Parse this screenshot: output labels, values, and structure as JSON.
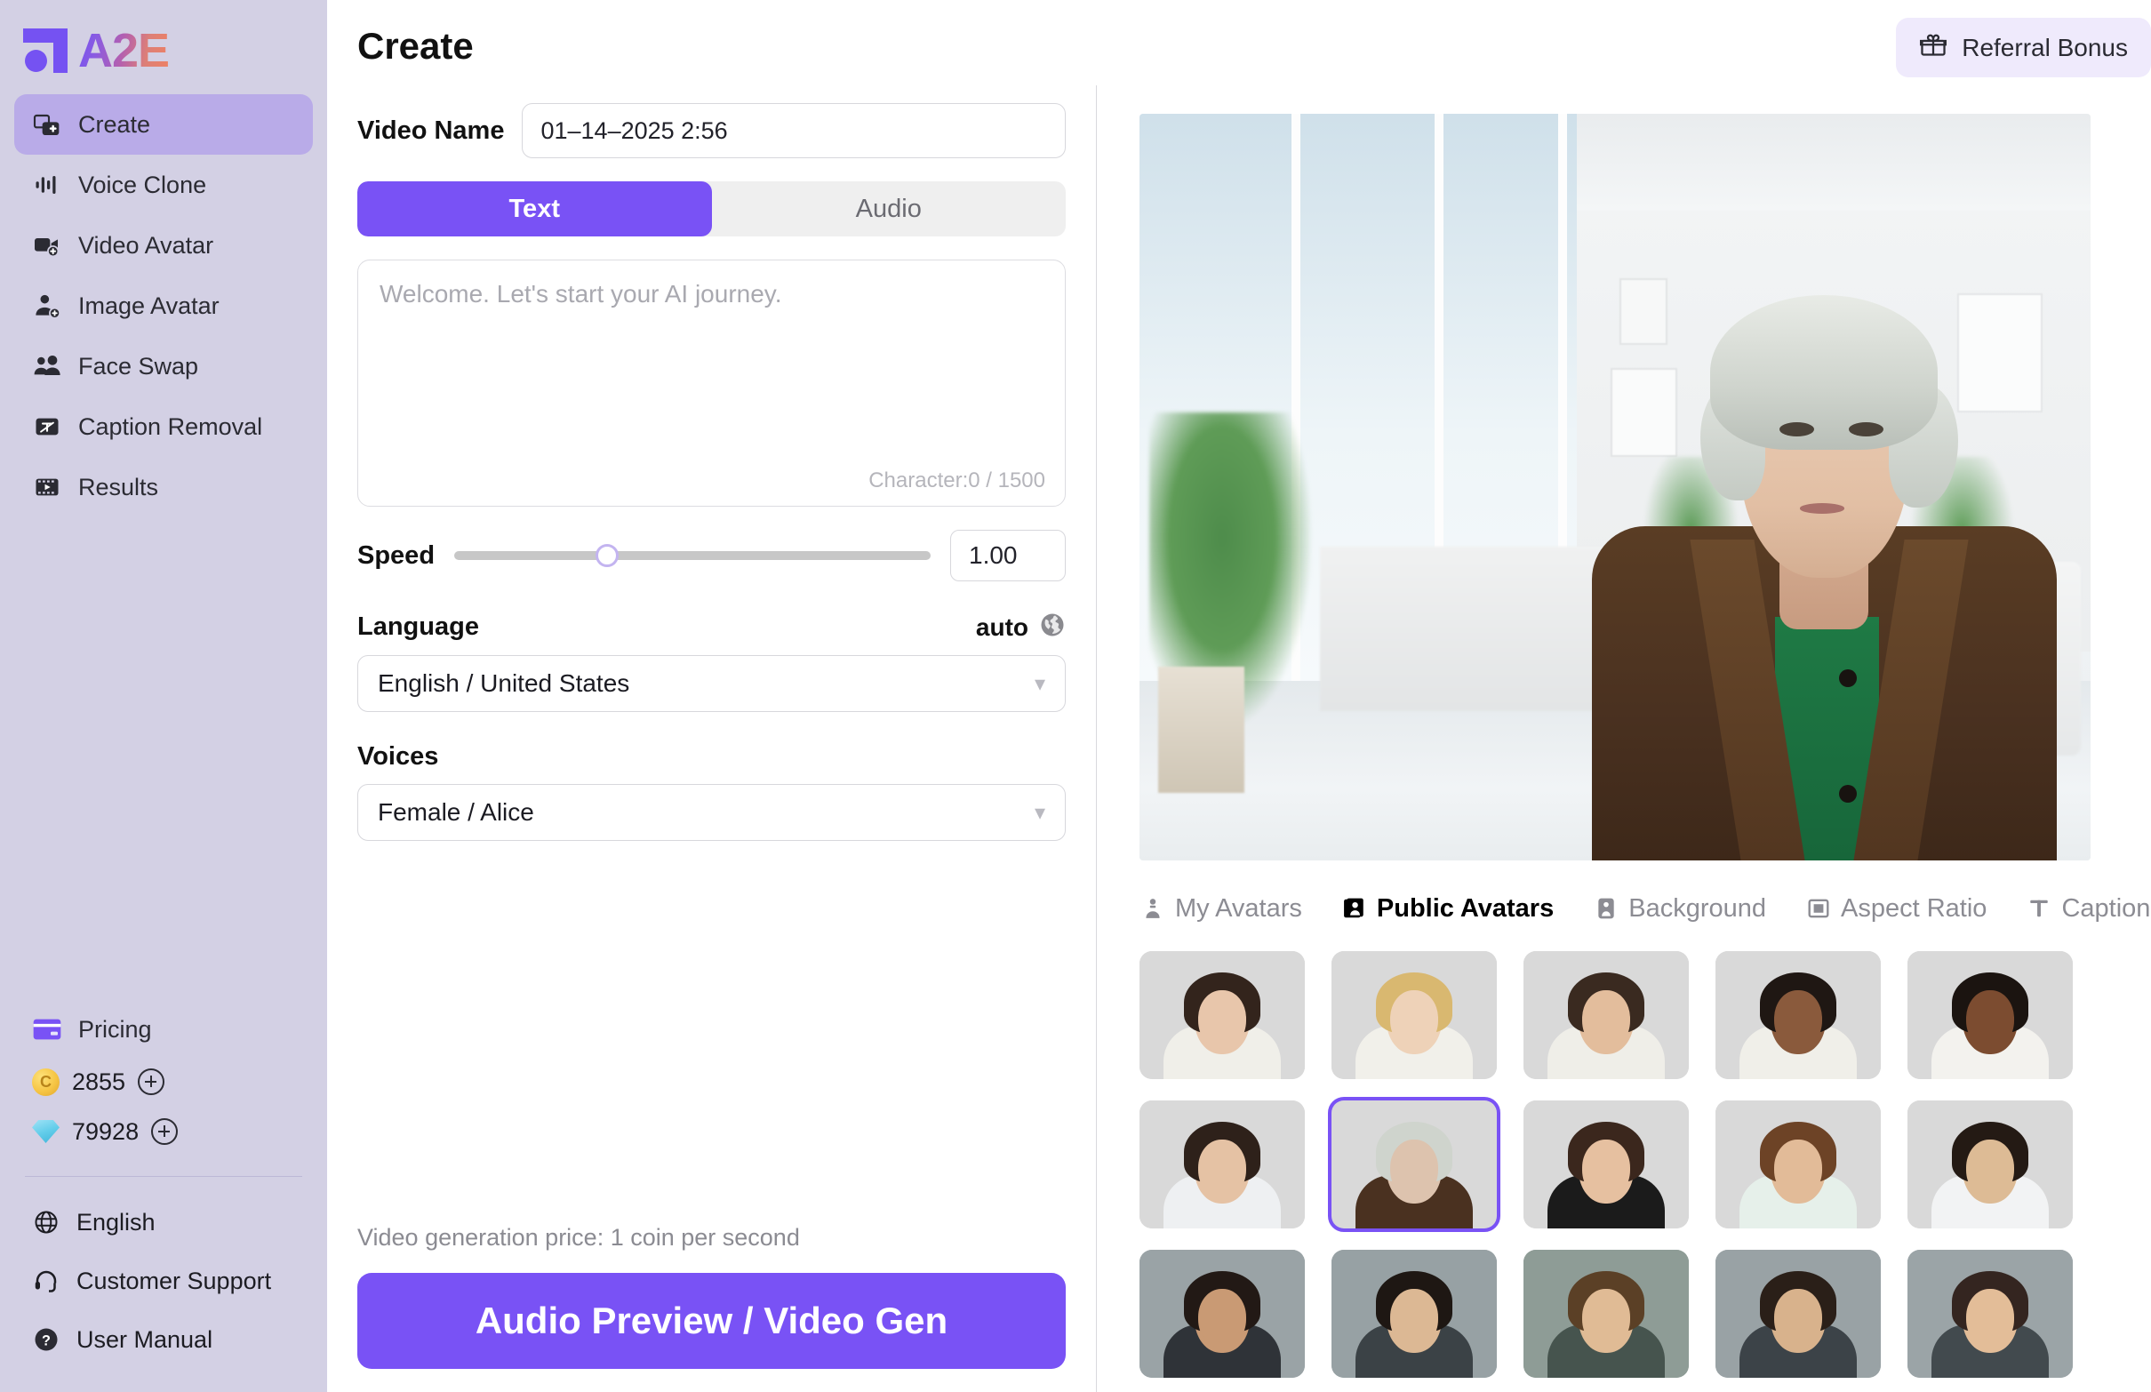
{
  "brand": {
    "name": "A2E"
  },
  "sidebar": {
    "items": [
      {
        "label": "Create",
        "icon": "create-icon",
        "active": true
      },
      {
        "label": "Voice Clone",
        "icon": "voice-clone-icon",
        "active": false
      },
      {
        "label": "Video Avatar",
        "icon": "video-avatar-icon",
        "active": false
      },
      {
        "label": "Image Avatar",
        "icon": "image-avatar-icon",
        "active": false
      },
      {
        "label": "Face Swap",
        "icon": "face-swap-icon",
        "active": false
      },
      {
        "label": "Caption Removal",
        "icon": "caption-removal-icon",
        "active": false
      },
      {
        "label": "Results",
        "icon": "results-icon",
        "active": false
      }
    ],
    "pricing": {
      "label": "Pricing",
      "icon": "credit-card-icon"
    },
    "credits": {
      "coins": {
        "value": "2855",
        "icon": "coin-icon",
        "add": "+"
      },
      "diamonds": {
        "value": "79928",
        "icon": "diamond-icon",
        "add": "+"
      }
    },
    "footer": [
      {
        "label": "English",
        "icon": "globe-icon"
      },
      {
        "label": "Customer Support",
        "icon": "headset-icon"
      },
      {
        "label": "User Manual",
        "icon": "question-circle-icon"
      }
    ]
  },
  "header": {
    "title": "Create",
    "referral": {
      "label": "Referral Bonus",
      "icon": "gift-icon"
    }
  },
  "form": {
    "video_name_label": "Video Name",
    "video_name_value": "01–14–2025 2:56",
    "video_name_placeholder": "Video Name",
    "mode_tabs": [
      {
        "label": "Text",
        "active": true
      },
      {
        "label": "Audio",
        "active": false
      }
    ],
    "script_placeholder": "Welcome. Let's start your AI journey.",
    "script_value": "",
    "character_counter": "Character:0 / 1500",
    "speed_label": "Speed",
    "speed_value": "1.00",
    "speed_percent": 32,
    "language_label": "Language",
    "language_auto": "auto",
    "language_auto_icon": "globe-earth-icon",
    "language_value": "English / United States",
    "voices_label": "Voices",
    "voices_value": "Female / Alice",
    "price_note": "Video generation price: 1 coin per second",
    "cta_label": "Audio Preview / Video Gen"
  },
  "preview": {
    "alt": "AI avatar preview: elderly woman in brown coat and green top in a bright clinic",
    "tabs": [
      {
        "label": "My Avatars",
        "icon": "person-badge-icon",
        "active": false
      },
      {
        "label": "Public Avatars",
        "icon": "people-card-icon",
        "active": true
      },
      {
        "label": "Background",
        "icon": "image-person-icon",
        "active": false
      },
      {
        "label": "Aspect Ratio",
        "icon": "aspect-ratio-icon",
        "active": false
      },
      {
        "label": "Caption",
        "icon": "text-type-icon",
        "active": false
      }
    ],
    "avatars": [
      {
        "name": "avatar-1",
        "skin": "#e8c6ab",
        "hair": "#33241c",
        "shirt": "#f0efe9",
        "bg": "#d9d9d9",
        "selected": false
      },
      {
        "name": "avatar-2",
        "skin": "#eed2b8",
        "hair": "#d9b870",
        "shirt": "#f1f0ea",
        "bg": "#d9d9d9",
        "selected": false
      },
      {
        "name": "avatar-3",
        "skin": "#e3bd9c",
        "hair": "#3a2a20",
        "shirt": "#efeee8",
        "bg": "#d9d9d9",
        "selected": false
      },
      {
        "name": "avatar-4",
        "skin": "#8a5a3c",
        "hair": "#1f1713",
        "shirt": "#f0efe9",
        "bg": "#d9d9d9",
        "selected": false
      },
      {
        "name": "avatar-5",
        "skin": "#7c4c30",
        "hair": "#1b1410",
        "shirt": "#f3f2ee",
        "bg": "#d9d9d9",
        "selected": false
      },
      {
        "name": "avatar-6",
        "skin": "#e5c2a4",
        "hair": "#2e211a",
        "shirt": "#eef0f2",
        "bg": "#d9d9d9",
        "selected": false
      },
      {
        "name": "avatar-7",
        "skin": "#ddc3ae",
        "hair": "#cfd4cd",
        "shirt": "#4a3120",
        "bg": "#d9d9d9",
        "selected": true
      },
      {
        "name": "avatar-8",
        "skin": "#e6c0a0",
        "hair": "#3b271d",
        "shirt": "#1b1b1b",
        "bg": "#d9d9d9",
        "selected": false
      },
      {
        "name": "avatar-9",
        "skin": "#e2bb98",
        "hair": "#6d4326",
        "shirt": "#e6f0ea",
        "bg": "#d9d9d9",
        "selected": false
      },
      {
        "name": "avatar-10",
        "skin": "#ddbb95",
        "hair": "#241a14",
        "shirt": "#f2f3f4",
        "bg": "#d9d9d9",
        "selected": false
      },
      {
        "name": "avatar-11",
        "skin": "#c99a74",
        "hair": "#221915",
        "shirt": "#2f3338",
        "bg": "#9aa3a6",
        "selected": false
      },
      {
        "name": "avatar-12",
        "skin": "#dcb894",
        "hair": "#1e1713",
        "shirt": "#3b4246",
        "bg": "#97a1a4",
        "selected": false
      },
      {
        "name": "avatar-13",
        "skin": "#e0bb95",
        "hair": "#5b4026",
        "shirt": "#46544e",
        "bg": "#8e9c96",
        "selected": false
      },
      {
        "name": "avatar-14",
        "skin": "#d8b28c",
        "hair": "#2a1f18",
        "shirt": "#3c4348",
        "bg": "#99a2a5",
        "selected": false
      },
      {
        "name": "avatar-15",
        "skin": "#e3bd98",
        "hair": "#342520",
        "shirt": "#424a4e",
        "bg": "#9ba4a7",
        "selected": false
      }
    ]
  },
  "colors": {
    "accent": "#7952f5",
    "sidebar_bg": "#d3d0e4",
    "sidebar_active": "#b9abe8",
    "referral_bg": "#efeafc",
    "thumb_bg": "#d9d9d9"
  }
}
